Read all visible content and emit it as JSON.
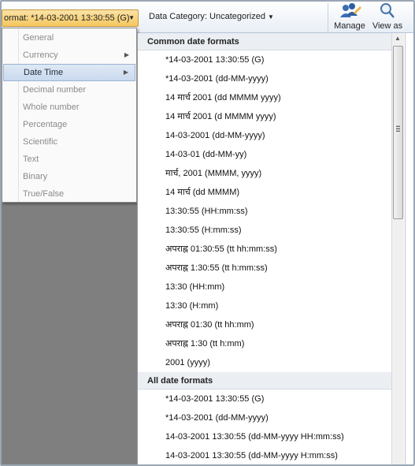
{
  "ribbon": {
    "format_label": "ormat: *14-03-2001 13:30:55 (G)",
    "category_label": "Data Category: Uncategorized",
    "manage_label": "Manage",
    "view_as_label": "View as"
  },
  "menu": {
    "items": [
      {
        "label": "General"
      },
      {
        "label": "Currency"
      },
      {
        "label": "Date Time"
      },
      {
        "label": "Decimal number"
      },
      {
        "label": "Whole number"
      },
      {
        "label": "Percentage"
      },
      {
        "label": "Scientific"
      },
      {
        "label": "Text"
      },
      {
        "label": "Binary"
      },
      {
        "label": "True/False"
      }
    ],
    "selected": "Date Time"
  },
  "submenu": {
    "common_header": "Common date formats",
    "common": [
      "*14-03-2001 13:30:55 (G)",
      "*14-03-2001 (dd-MM-yyyy)",
      "14 मार्च 2001 (dd MMMM yyyy)",
      "14 मार्च 2001 (d MMMM yyyy)",
      "14-03-2001 (dd-MM-yyyy)",
      "14-03-01 (dd-MM-yy)",
      "मार्च, 2001 (MMMM, yyyy)",
      "14 मार्च (dd MMMM)",
      "13:30:55 (HH:mm:ss)",
      "13:30:55 (H:mm:ss)",
      "अपराह्न 01:30:55 (tt hh:mm:ss)",
      "अपराह्न 1:30:55 (tt h:mm:ss)",
      "13:30 (HH:mm)",
      "13:30 (H:mm)",
      "अपराह्न 01:30 (tt hh:mm)",
      "अपराह्न 1:30 (tt h:mm)",
      "2001 (yyyy)"
    ],
    "all_header": "All date formats",
    "all": [
      "*14-03-2001 13:30:55 (G)",
      "*14-03-2001 (dd-MM-yyyy)",
      "14-03-2001 13:30:55 (dd-MM-yyyy HH:mm:ss)",
      "14-03-2001 13:30:55 (dd-MM-yyyy H:mm:ss)"
    ]
  },
  "icons": {
    "submenu_arrow": "triangle-right-icon",
    "dropdown_arrow": "triangle-down-icon",
    "manage": "users-icon",
    "view_as": "magnifier-icon"
  }
}
